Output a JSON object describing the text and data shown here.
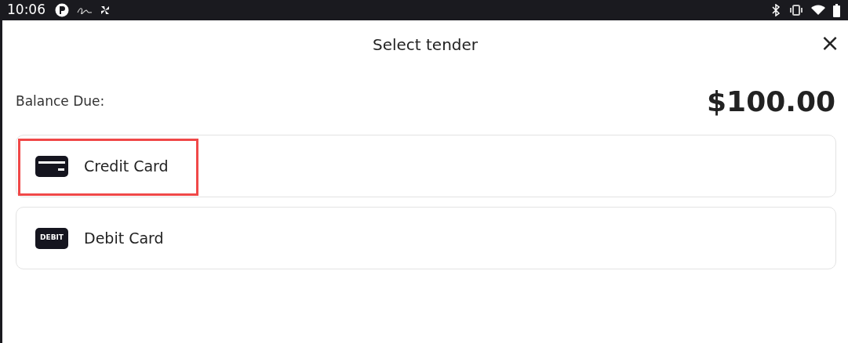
{
  "status_bar": {
    "time": "10:06"
  },
  "dialog": {
    "title": "Select tender",
    "close": "×"
  },
  "balance": {
    "label": "Balance Due:",
    "amount": "$100.00"
  },
  "tenders": [
    {
      "kind": "card",
      "label": "Credit Card",
      "highlighted": true
    },
    {
      "kind": "badge",
      "badge": "DEBIT",
      "label": "Debit Card",
      "highlighted": false
    }
  ]
}
